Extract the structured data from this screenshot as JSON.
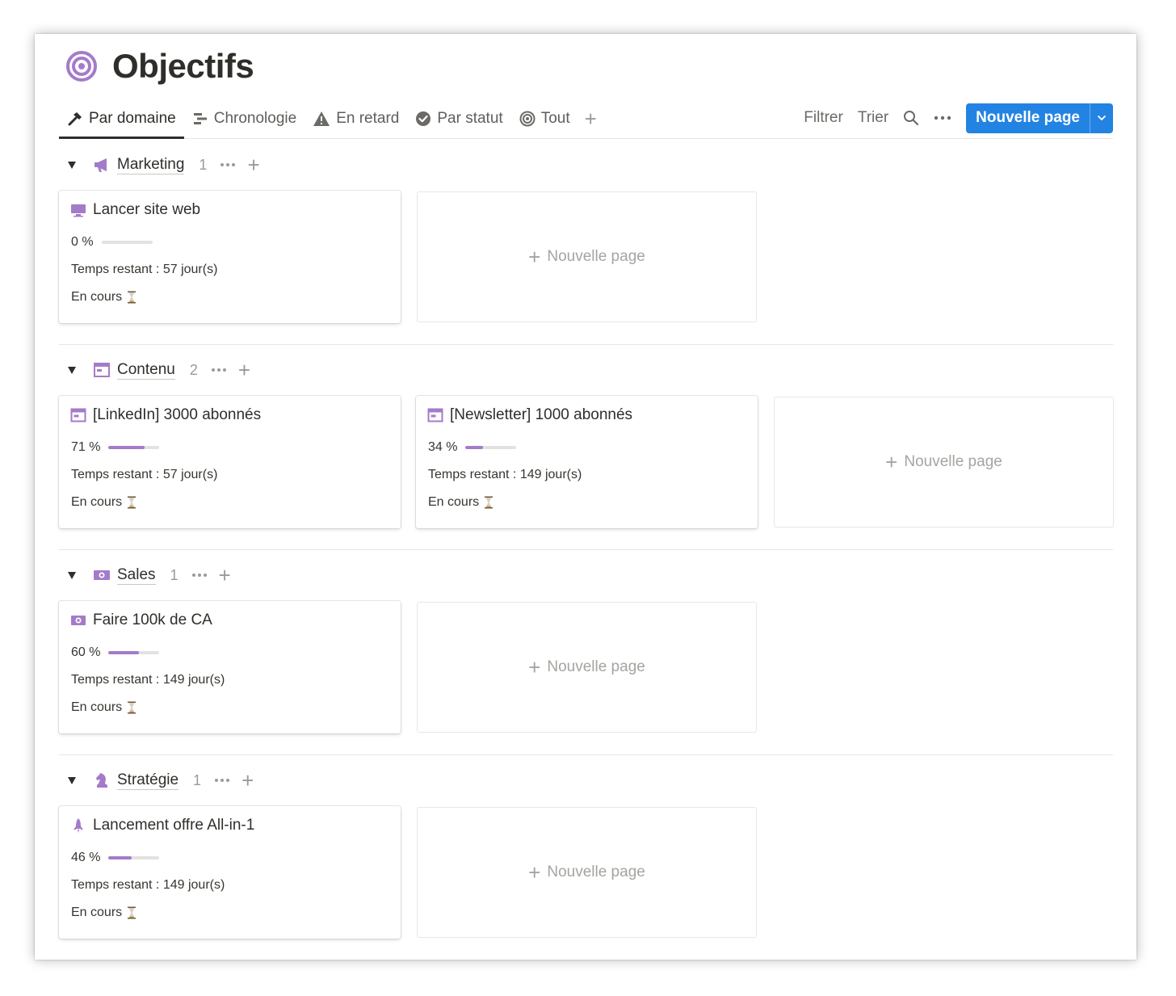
{
  "page": {
    "title": "Objectifs",
    "title_icon": "target-icon",
    "accent": "#a47bc9"
  },
  "tabs": [
    {
      "label": "Par domaine",
      "icon": "hammer-icon",
      "active": true
    },
    {
      "label": "Chronologie",
      "icon": "timeline-icon",
      "active": false
    },
    {
      "label": "En retard",
      "icon": "warning-icon",
      "active": false
    },
    {
      "label": "Par statut",
      "icon": "check-circle-icon",
      "active": false
    },
    {
      "label": "Tout",
      "icon": "target-icon",
      "active": false
    }
  ],
  "toolbar": {
    "filter": "Filtrer",
    "sort": "Trier",
    "new_page": "Nouvelle page",
    "button_color": "#2383e2"
  },
  "new_card_label": "Nouvelle page",
  "groups": [
    {
      "name": "Marketing",
      "count": "1",
      "icon": "megaphone-icon",
      "cards": [
        {
          "title": "Lancer site web",
          "icon": "computer-icon",
          "percent": "0 %",
          "progress": 0,
          "time": "Temps restant : 57 jour(s)",
          "status": "En cours"
        }
      ]
    },
    {
      "name": "Contenu",
      "count": "2",
      "icon": "layout-icon",
      "cards": [
        {
          "title": "[LinkedIn] 3000 abonnés",
          "icon": "layout-icon",
          "percent": "71 %",
          "progress": 0.71,
          "time": "Temps restant : 57 jour(s)",
          "status": "En cours"
        },
        {
          "title": "[Newsletter] 1000 abonnés",
          "icon": "layout-icon",
          "percent": "34 %",
          "progress": 0.34,
          "time": "Temps restant : 149 jour(s)",
          "status": "En cours"
        }
      ]
    },
    {
      "name": "Sales",
      "count": "1",
      "icon": "money-icon",
      "cards": [
        {
          "title": "Faire 100k de CA",
          "icon": "money-icon",
          "percent": "60 %",
          "progress": 0.6,
          "time": "Temps restant : 149 jour(s)",
          "status": "En cours"
        }
      ]
    },
    {
      "name": "Stratégie",
      "count": "1",
      "icon": "chess-knight-icon",
      "cards": [
        {
          "title": "Lancement offre All-in-1",
          "icon": "rocket-icon",
          "percent": "46 %",
          "progress": 0.46,
          "time": "Temps restant : 149 jour(s)",
          "status": "En cours"
        }
      ]
    }
  ]
}
